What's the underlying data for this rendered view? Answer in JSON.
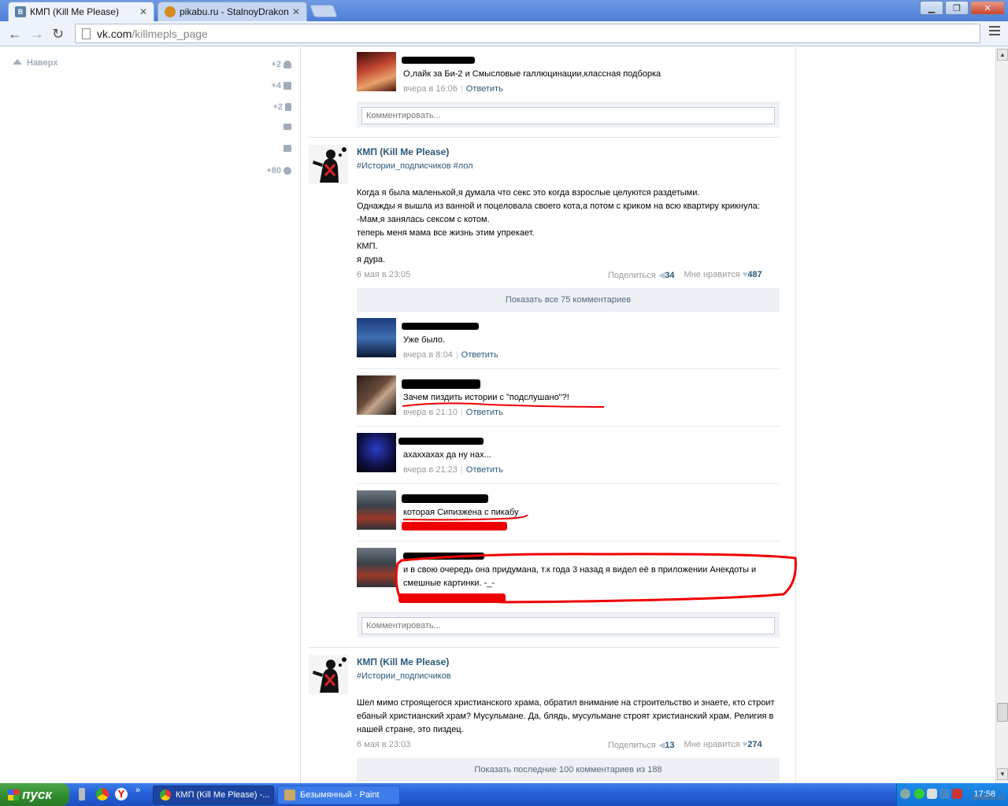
{
  "browser": {
    "tabs": [
      {
        "title": "КМП (Kill Me Please)",
        "favicon": "В",
        "favicon_color": "#5b7fa6",
        "active": true
      },
      {
        "title": "pikabu.ru - StalnoyDrakon",
        "favicon": "",
        "favicon_color": "#d68a1f",
        "active": false
      }
    ],
    "url_host": "vk.com",
    "url_path": "/killmepls_page"
  },
  "sidebar": {
    "up_label": "Наверх",
    "counters": [
      {
        "value": "+2",
        "icon": "user-icon"
      },
      {
        "value": "+4",
        "icon": "camera-icon"
      },
      {
        "value": "+2",
        "icon": "film-icon"
      },
      {
        "value": "",
        "icon": "mail-icon"
      },
      {
        "value": "",
        "icon": "comment-icon"
      },
      {
        "value": "+80",
        "icon": "gear-icon"
      }
    ]
  },
  "top_comment": {
    "text": "О,лайк за Би-2 и Смысловые галлюцинации,классная подборка",
    "time": "вчера в 16:06",
    "reply": "Ответить"
  },
  "comment_placeholder": "Комментировать...",
  "post1": {
    "author": "КМП (Kill Me Please)",
    "tags": "#Истории_подписчиков #лол",
    "lines": [
      "Когда я была маленькой,я думала что секс это когда взрослые целуются раздетыми.",
      "Однажды я вышла из ванной и поцеловала своего кота,а потом с криком на всю квартиру крикнула:",
      "-Мам,я занялась сексом с котом.",
      "теперь меня мама все жизнь этим упрекает.",
      "КМП.",
      "я дура."
    ],
    "date": "6 мая в 23:05",
    "share_label": "Поделиться",
    "share_count": "34",
    "like_label": "Мне нравится",
    "like_count": "487",
    "show_all": "Показать все 75 комментариев",
    "comments": [
      {
        "text": "Уже было.",
        "time": "вчера в 8:04",
        "reply": "Ответить"
      },
      {
        "text": "Зачем пиздить истории с \"подслушано\"?!",
        "time": "вчера в 21:10",
        "reply": "Ответить"
      },
      {
        "text": "ахаххахах да ну нах...",
        "time": "вчера в 21:23",
        "reply": "Ответить"
      },
      {
        "text": "которая Сипизжена с пикабу",
        "time": "",
        "reply": ""
      },
      {
        "text": "и в свою очередь она придумана, т.к года 3 назад я видел её в приложении Анекдоты и",
        "text2": "смешные картинки. -_-",
        "time": "",
        "reply": ""
      }
    ]
  },
  "post2": {
    "author": "КМП (Kill Me Please)",
    "tags": "#Истории_подписчиков",
    "lines": [
      "Шел мимо строящегося христианского храма, обратил внимание на строительство и знаете, кто строит",
      "ебаный христианский храм? Мусульмане. Да, блядь, мусульмане строят христианский храм. Религия в",
      "нашей стране, это пиздец."
    ],
    "date": "6 мая в 23:03",
    "share_label": "Поделиться",
    "share_count": "13",
    "like_label": "Мне нравится",
    "like_count": "274",
    "show_all": "Показать последние 100 комментариев из 188"
  },
  "taskbar": {
    "start_label": "пуск",
    "tasks": [
      {
        "label": "КМП (Kill Me Please) -...",
        "active": true
      },
      {
        "label": "Безымянный - Paint",
        "active": false
      }
    ],
    "clock": "17:58"
  },
  "watermark": "pikabu.ru"
}
